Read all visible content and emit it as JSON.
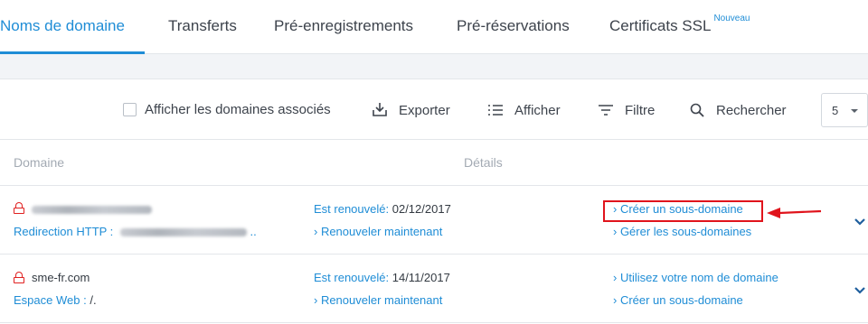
{
  "tabs": [
    {
      "label": "Noms de domaine",
      "active": true
    },
    {
      "label": "Transferts"
    },
    {
      "label": "Pré-enregistrements"
    },
    {
      "label": "Pré-réservations"
    },
    {
      "label": "Certificats SSL",
      "badge": "Nouveau"
    }
  ],
  "toolbar": {
    "associated_checkbox_label": "Afficher les domaines associés",
    "export_label": "Exporter",
    "display_label": "Afficher",
    "filter_label": "Filtre",
    "search_label": "Rechercher",
    "page_size": "5",
    "icons": [
      "download-icon",
      "list-icon",
      "filter-icon",
      "search-icon"
    ]
  },
  "table": {
    "columns": [
      "Domaine",
      "Détails"
    ],
    "rows": [
      {
        "domain": "",
        "sub_label": "Redirection HTTP :",
        "sub_value": "..",
        "renewal_label": "Est renouvelé:",
        "renewal_date": "02/12/2017",
        "renew_now": "› Renouveler maintenant",
        "actions": [
          "› Créer un sous-domaine",
          "› Gérer les sous-domaines"
        ]
      },
      {
        "domain": "sme-fr.com",
        "sub_label": "Espace Web :",
        "sub_value": "/.",
        "renewal_label": "Est renouvelé:",
        "renewal_date": "14/11/2017",
        "renew_now": "› Renouveler maintenant",
        "actions": [
          "› Utilisez votre nom de domaine",
          "› Créer un sous-domaine"
        ]
      }
    ]
  },
  "colors": {
    "accent": "#1f8dd6",
    "annotation_red": "#e0141c",
    "lock_red": "#e02020"
  }
}
